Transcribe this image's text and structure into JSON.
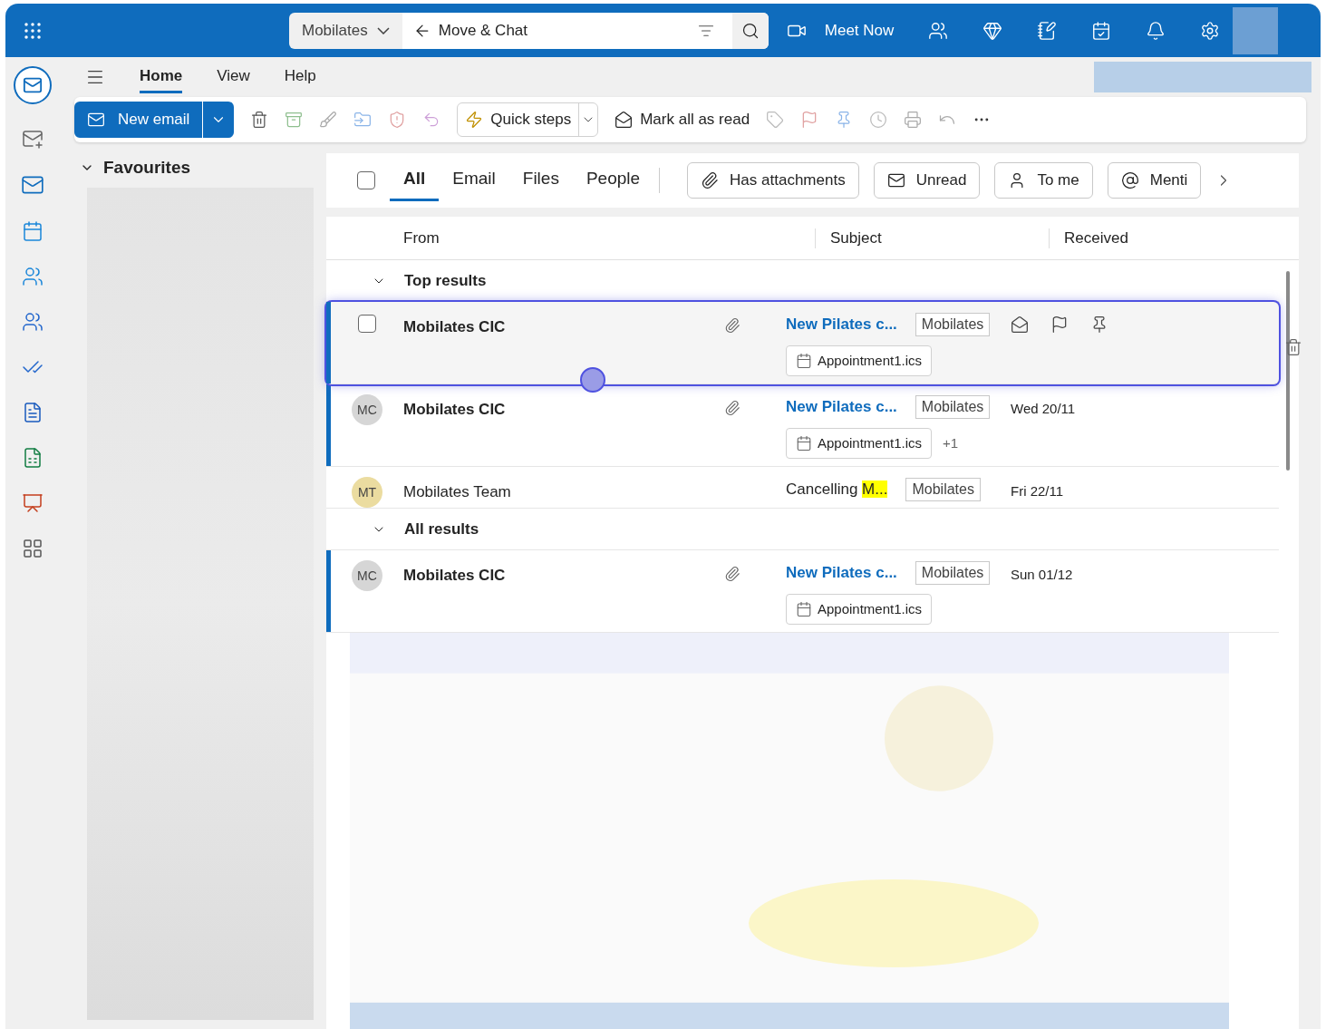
{
  "search": {
    "scope": "Mobilates",
    "query": "Move & Chat"
  },
  "top_bar": {
    "meet_now": "Meet Now"
  },
  "ribbon_tabs": [
    {
      "label": "Home",
      "selected": true
    },
    {
      "label": "View",
      "selected": false
    },
    {
      "label": "Help",
      "selected": false
    }
  ],
  "toolbar": {
    "new_email": "New email",
    "quick_steps": "Quick steps",
    "mark_all_read": "Mark all as read"
  },
  "folder_pane": {
    "title": "Favourites",
    "expanded": true
  },
  "select_all": {
    "checked": false
  },
  "filter_tabs": [
    {
      "label": "All",
      "selected": true
    },
    {
      "label": "Email",
      "selected": false
    },
    {
      "label": "Files",
      "selected": false
    },
    {
      "label": "People",
      "selected": false
    }
  ],
  "filters": [
    {
      "kind": "attachment",
      "label": "Has attachments"
    },
    {
      "kind": "unread",
      "label": "Unread"
    },
    {
      "kind": "person",
      "label": "To me"
    },
    {
      "kind": "mention",
      "label": "Menti"
    }
  ],
  "columns": [
    "From",
    "Subject",
    "Received"
  ],
  "groups": [
    {
      "title": "Top results",
      "expanded": true,
      "rows": [
        {
          "sender": "Mobilates CIC",
          "unread": true,
          "selected": true,
          "has_attachment": true,
          "subject": "New Pilates c...",
          "category": "Mobilates",
          "attachment": "Appointment1.ics"
        },
        {
          "sender": "Mobilates CIC",
          "initials": "MC",
          "color": "#d6d6d6",
          "unread": true,
          "selected": false,
          "has_attachment": true,
          "subject": "New Pilates c...",
          "category": "Mobilates",
          "attachment": "Appointment1.ics",
          "extra": "+1",
          "received": "Wed 20/11"
        },
        {
          "sender": "Mobilates Team",
          "initials": "MT",
          "color": "#ebdca0",
          "unread": false,
          "selected": false,
          "has_attachment": false,
          "subject": "Cancelling ",
          "highlight": "M...",
          "category": "Mobilates",
          "received": "Fri 22/11"
        }
      ]
    },
    {
      "title": "All results",
      "expanded": true,
      "rows": [
        {
          "sender": "Mobilates CIC",
          "initials": "MC",
          "color": "#d6d6d6",
          "unread": true,
          "selected": false,
          "has_attachment": true,
          "subject": "New Pilates c...",
          "category": "Mobilates",
          "attachment": "Appointment1.ics",
          "received": "Sun 01/12"
        }
      ]
    }
  ]
}
